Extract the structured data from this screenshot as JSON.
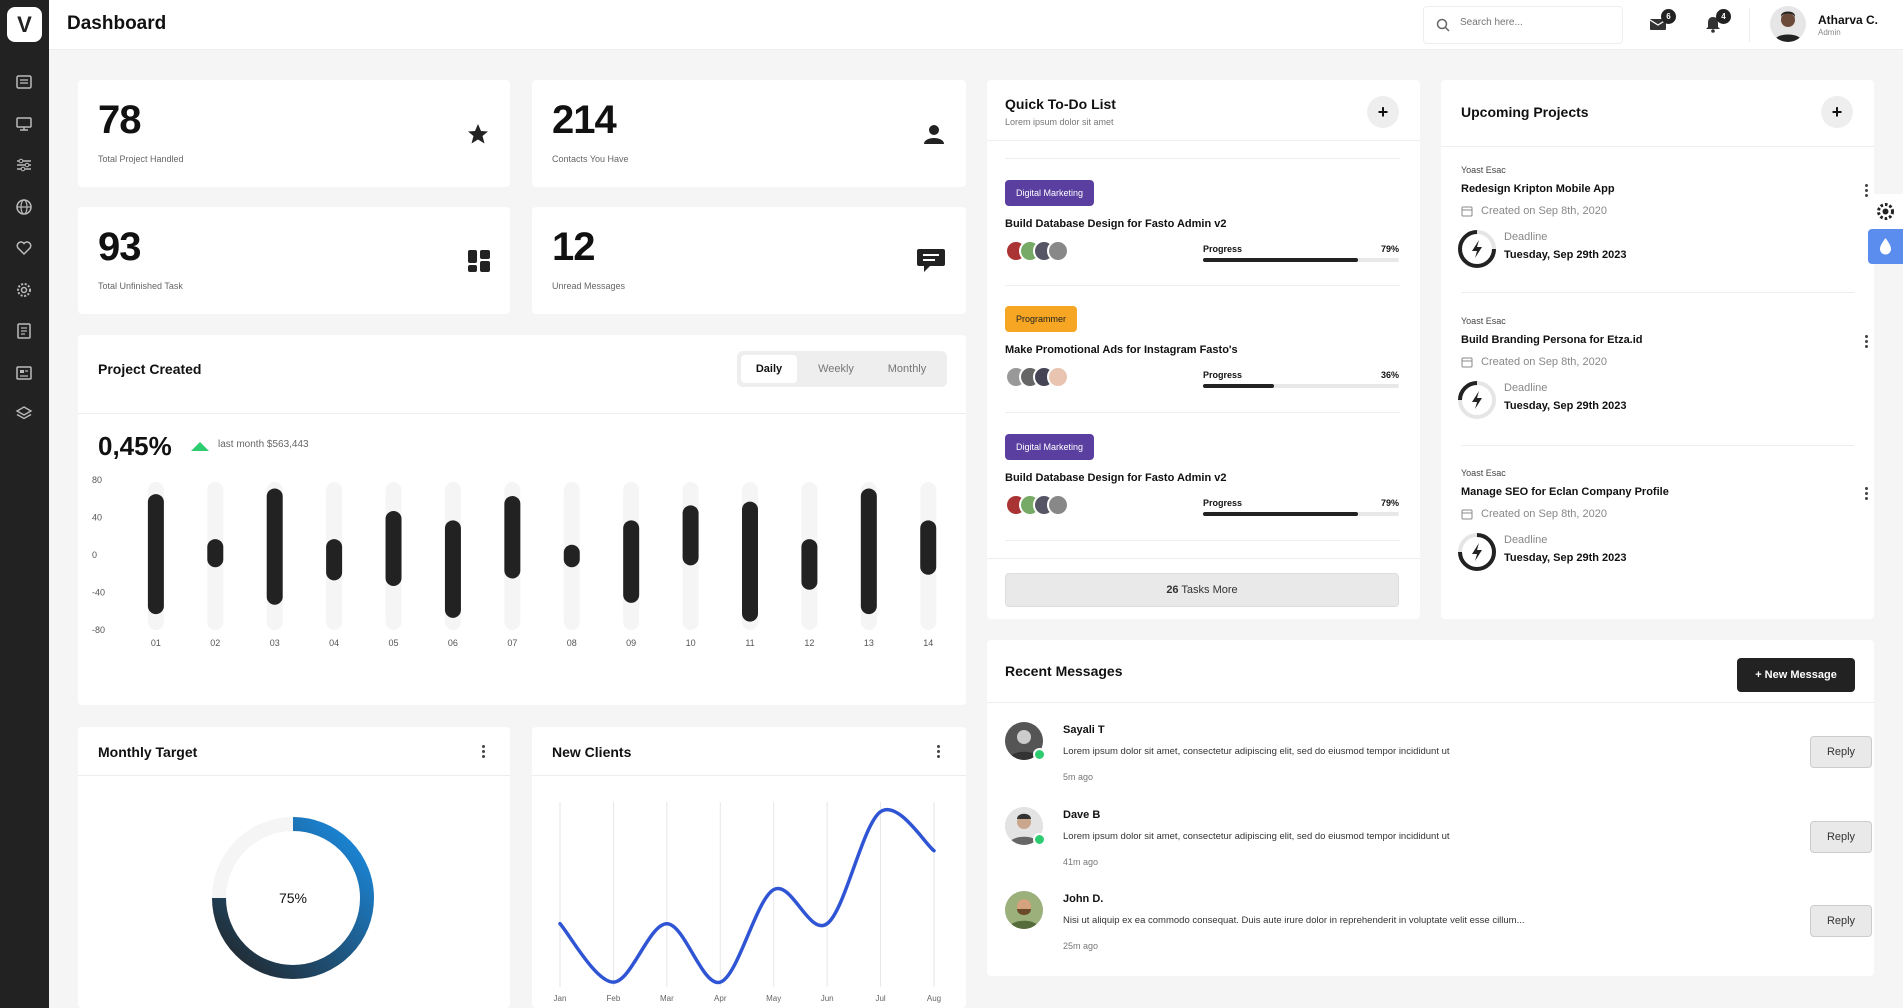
{
  "app": {
    "logo_letter": "V",
    "page_title": "Dashboard"
  },
  "search": {
    "placeholder": "Search here..."
  },
  "notifications": {
    "messages_count": "6",
    "alerts_count": "4"
  },
  "user": {
    "name": "Atharva C.",
    "role": "Admin"
  },
  "sidebar": {
    "icons": [
      "news-icon",
      "monitor-icon",
      "sliders-icon",
      "globe-icon",
      "heart-icon",
      "settings-icon",
      "book-icon",
      "article-icon",
      "layers-icon"
    ]
  },
  "stats": [
    {
      "value": "78",
      "label": "Total Project Handled",
      "icon": "star-icon"
    },
    {
      "value": "214",
      "label": "Contacts You Have",
      "icon": "user-icon"
    },
    {
      "value": "93",
      "label": "Total Unfinished Task",
      "icon": "dashboard-icon"
    },
    {
      "value": "12",
      "label": "Unread Messages",
      "icon": "chat-icon"
    }
  ],
  "project_created": {
    "title": "Project Created",
    "tabs": [
      "Daily",
      "Weekly",
      "Monthly"
    ],
    "active_tab": "Daily",
    "percent": "0,45%",
    "last_month": "last month $563,443"
  },
  "chart_data": [
    {
      "type": "bar",
      "subtype": "floating-range",
      "ylim": [
        -80,
        80
      ],
      "yticks": [
        "80",
        "40",
        "0",
        "-40",
        "-80"
      ],
      "categories": [
        "01",
        "02",
        "03",
        "04",
        "05",
        "06",
        "07",
        "08",
        "09",
        "10",
        "11",
        "12",
        "13",
        "14"
      ],
      "ranges": [
        [
          -63,
          65
        ],
        [
          -13,
          17
        ],
        [
          -53,
          71
        ],
        [
          -27,
          17
        ],
        [
          -33,
          47
        ],
        [
          -67,
          37
        ],
        [
          -25,
          63
        ],
        [
          -13,
          11
        ],
        [
          -51,
          37
        ],
        [
          -11,
          53
        ],
        [
          -71,
          57
        ],
        [
          -37,
          17
        ],
        [
          -63,
          71
        ],
        [
          -21,
          37
        ]
      ],
      "colors": {
        "bar": "#222222",
        "track": "#f5f5f5"
      }
    },
    {
      "type": "line",
      "title": "New Clients",
      "categories": [
        "Jan",
        "Feb",
        "Mar",
        "Apr",
        "May",
        "Jun",
        "Jul",
        "Aug"
      ],
      "values": [
        65,
        5,
        65,
        5,
        100,
        65,
        180,
        140
      ],
      "ylim": [
        0,
        190
      ],
      "colors": {
        "line": "#2f55d4"
      }
    },
    {
      "type": "pie",
      "subtype": "donut",
      "title": "Monthly Target",
      "values": [
        75,
        25
      ],
      "center_label": "75%",
      "colors": {
        "start": "#222222",
        "end": "#1a8fe8",
        "rest": "#f5f5f5"
      }
    }
  ],
  "monthly_target": {
    "title": "Monthly Target",
    "percent_label": "75%"
  },
  "new_clients": {
    "title": "New Clients"
  },
  "todo": {
    "title": "Quick To-Do List",
    "subtitle": "Lorem ipsum dolor sit amet",
    "add_label": "+",
    "items": [
      {
        "tag": "Digital Marketing",
        "tag_color": "#5a3fa0",
        "title": "Build Database Design for Fasto Admin v2",
        "progress_label": "Progress",
        "progress_text": "79%",
        "progress": 0.79
      },
      {
        "tag": "Programmer",
        "tag_color": "#f6a623",
        "title": "Make Promotional Ads for Instagram Fasto's",
        "progress_label": "Progress",
        "progress_text": "36%",
        "progress": 0.36
      },
      {
        "tag": "Digital Marketing",
        "tag_color": "#5a3fa0",
        "title": "Build Database Design for Fasto Admin v2",
        "progress_label": "Progress",
        "progress_text": "79%",
        "progress": 0.79
      }
    ],
    "more_count": "26",
    "more_label": "Tasks More"
  },
  "upcoming": {
    "title": "Upcoming Projects",
    "add_label": "+",
    "items": [
      {
        "company": "Yoast Esac",
        "title": "Redesign Kripton Mobile App",
        "created": "Created on Sep 8th, 2020",
        "deadline_label": "Deadline",
        "deadline": "Tuesday, Sep 29th 2023"
      },
      {
        "company": "Yoast Esac",
        "title": "Build Branding Persona for Etza.id",
        "created": "Created on Sep 8th, 2020",
        "deadline_label": "Deadline",
        "deadline": "Tuesday, Sep 29th 2023"
      },
      {
        "company": "Yoast Esac",
        "title": "Manage SEO for Eclan Company Profile",
        "created": "Created on Sep 8th, 2020",
        "deadline_label": "Deadline",
        "deadline": "Tuesday, Sep 29th 2023"
      }
    ]
  },
  "messages": {
    "title": "Recent Messages",
    "new_label": "+ New Message",
    "items": [
      {
        "name": "Sayali T",
        "text": "Lorem ipsum dolor sit amet, consectetur adipiscing elit, sed do eiusmod tempor incididunt ut",
        "time": "5m ago",
        "reply": "Reply",
        "online": true
      },
      {
        "name": "Dave B",
        "text": "Lorem ipsum dolor sit amet, consectetur adipiscing elit, sed do eiusmod tempor incididunt ut",
        "time": "41m ago",
        "reply": "Reply",
        "online": true
      },
      {
        "name": "John D.",
        "text": "Nisi ut aliquip ex ea commodo consequat. Duis aute irure dolor in reprehenderit in voluptate velit esse cillum...",
        "time": "25m ago",
        "reply": "Reply",
        "online": false
      }
    ]
  },
  "right_tools": {
    "icons": [
      "gear-icon",
      "droplet-icon"
    ],
    "accent": "#5b8def"
  }
}
